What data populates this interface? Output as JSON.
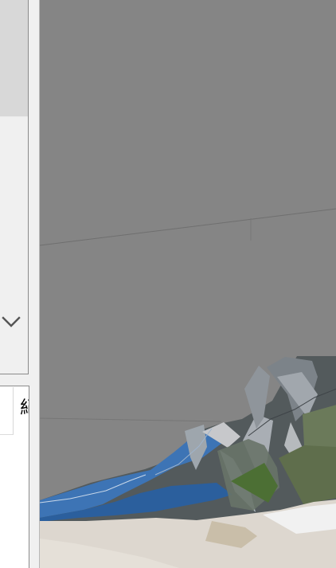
{
  "left_panel": {
    "card_text": "紀",
    "icons": {
      "expand": "chevron-down-icon"
    }
  },
  "viewport": {
    "scene": "3d-model-view",
    "colors": {
      "background": "#858585",
      "grid": "#6f6f6f"
    }
  }
}
